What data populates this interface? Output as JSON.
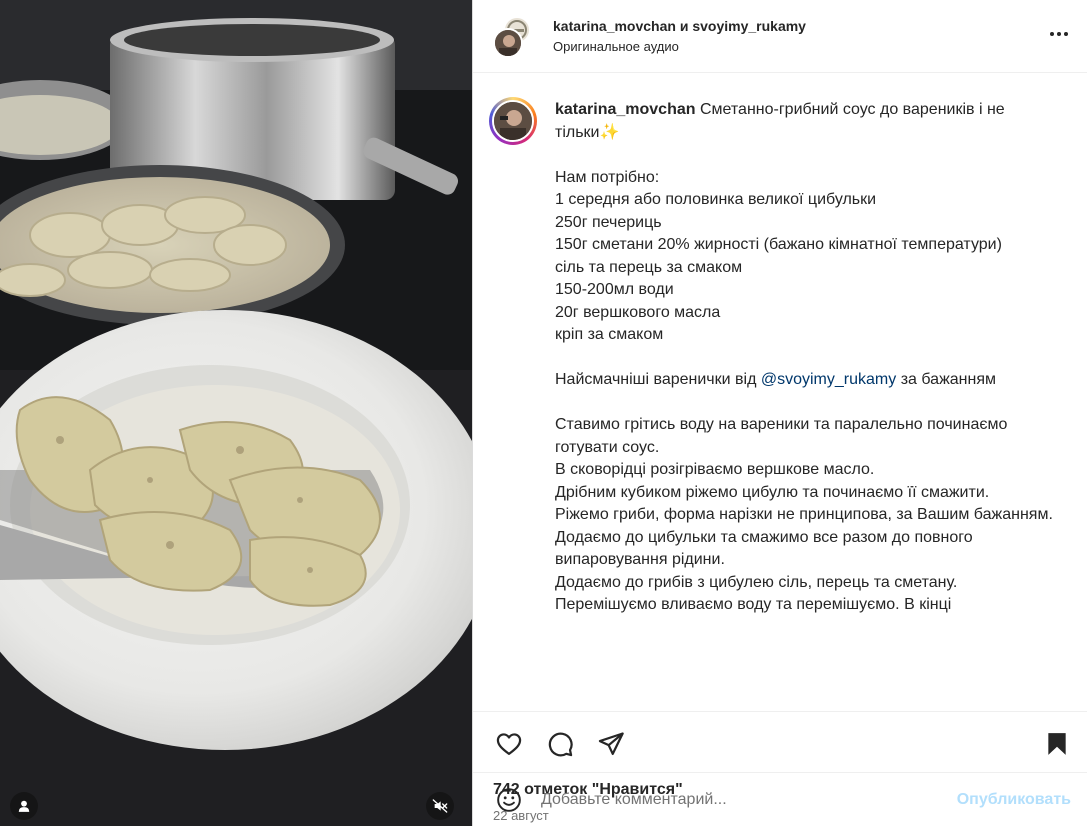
{
  "header": {
    "username_primary": "katarina_movchan",
    "joiner": "и",
    "username_secondary": "svoyimy_rukamy",
    "audio_label": "Оригинальное аудио"
  },
  "caption": {
    "username": "katarina_movchan",
    "title_text": "Сметанно-грибний соус до вареників і не тільки",
    "title_emoji": "✨",
    "ingredients_heading": "Нам потрібно:",
    "ingredients": [
      "1 середня або половинка великої цибульки",
      "250г печериць",
      "150г сметани 20% жирності (бажано кімнатної температури)",
      "сіль та перець за смаком",
      "150-200мл води",
      "20г вершкового масла",
      "кріп за смаком"
    ],
    "recommendation_prefix": "Найсмачніші варенички від",
    "recommendation_mention": "@svoyimy_rukamy",
    "recommendation_suffix": "за бажанням",
    "steps": [
      "Ставимо грітись воду на вареники та паралельно починаємо готувати соус.",
      "В сковорідці розігріваємо вершкове масло.",
      "Дрібним кубиком ріжемо цибулю та починаємо її смажити.",
      "Ріжемо гриби, форма нарізки не принципова, за Вашим бажанням.",
      "Додаємо до цибульки та смажимо все разом до повного випаровування рідини.",
      "Додаємо до грибів з цибулею сіль, перець та сметану.",
      "Перемішуємо вливаємо воду та перемішуємо. В кінці"
    ]
  },
  "stats": {
    "likes_text": "742 отметок \"Нравится\"",
    "date_text": "22 август"
  },
  "comment": {
    "placeholder": "Добавьте комментарий...",
    "post_label": "Опубликовать"
  },
  "colors": {
    "mention": "#00376b",
    "post_disabled": "#b2dffc",
    "muted_text": "#737373",
    "divider": "#efefef"
  },
  "icons": {
    "more": "more-horizontal-icon",
    "like": "heart-icon",
    "comment": "comment-bubble-icon",
    "share": "paper-plane-icon",
    "save": "bookmark-filled-icon",
    "emoji": "smiley-icon",
    "tagged_users": "user-icon",
    "audio": "speaker-muted-icon"
  }
}
